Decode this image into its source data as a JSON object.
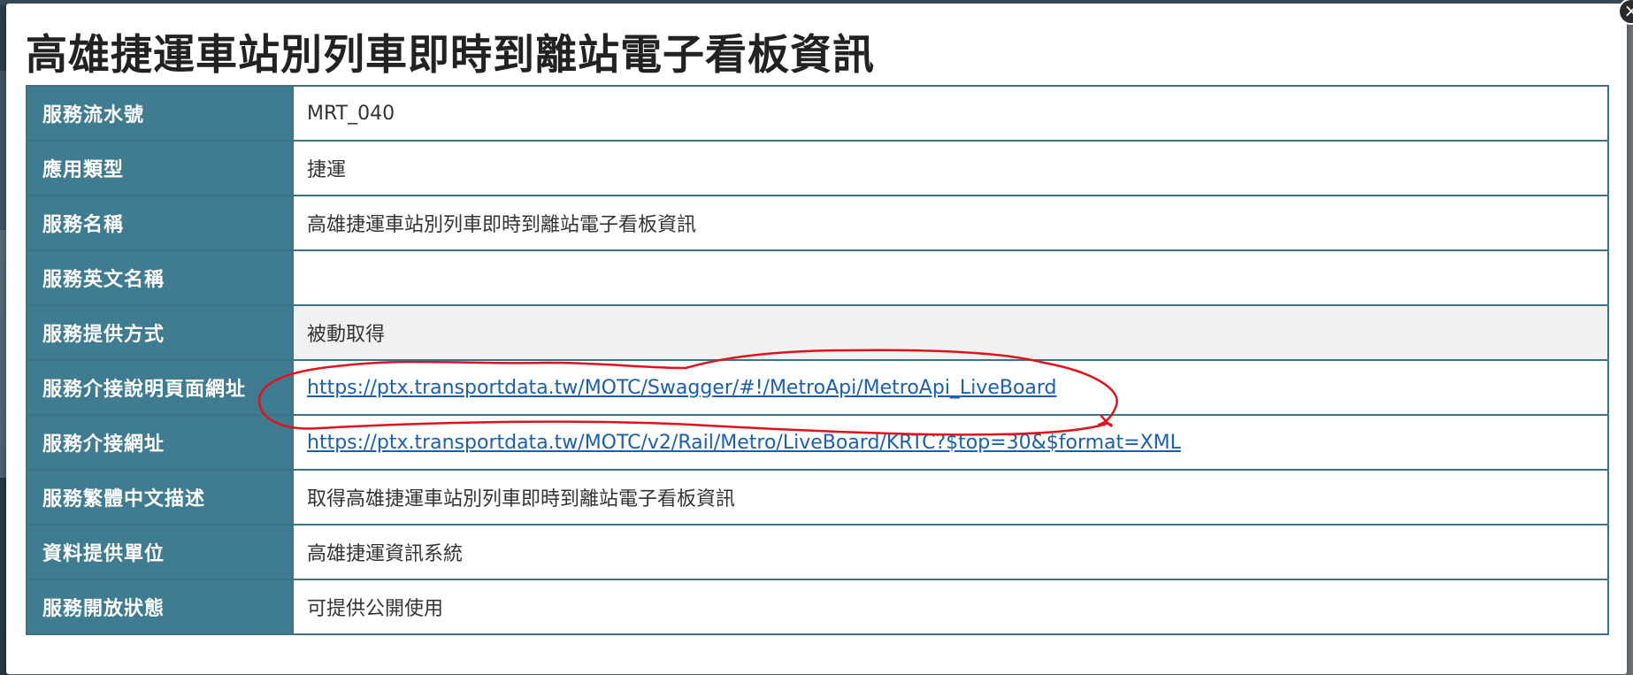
{
  "modal": {
    "title": "高雄捷運車站別列車即時到離站電子看板資訊",
    "close_label": "×"
  },
  "rows": [
    {
      "label": "服務流水號",
      "value": "MRT_040",
      "type": "text"
    },
    {
      "label": "應用類型",
      "value": "捷運",
      "type": "text"
    },
    {
      "label": "服務名稱",
      "value": "高雄捷運車站別列車即時到離站電子看板資訊",
      "type": "text"
    },
    {
      "label": "服務英文名稱",
      "value": "",
      "type": "text"
    },
    {
      "label": "服務提供方式",
      "value": "被動取得",
      "type": "text"
    },
    {
      "label": "服務介接說明頁面網址",
      "value": "https://ptx.transportdata.tw/MOTC/Swagger/#!/MetroApi/MetroApi_LiveBoard",
      "type": "link"
    },
    {
      "label": "服務介接網址",
      "value": "https://ptx.transportdata.tw/MOTC/v2/Rail/Metro/LiveBoard/KRTC?$top=30&$format=XML",
      "type": "link"
    },
    {
      "label": "服務繁體中文描述",
      "value": "取得高雄捷運車站別列車即時到離站電子看板資訊",
      "type": "text"
    },
    {
      "label": "資料提供單位",
      "value": "高雄捷運資訊系統",
      "type": "text"
    },
    {
      "label": "服務開放狀態",
      "value": "可提供公開使用",
      "type": "text"
    }
  ],
  "colors": {
    "label_bg": "#3f7c91",
    "border": "#3d7386",
    "link": "#1b5fae",
    "annotation": "#e0121b"
  }
}
